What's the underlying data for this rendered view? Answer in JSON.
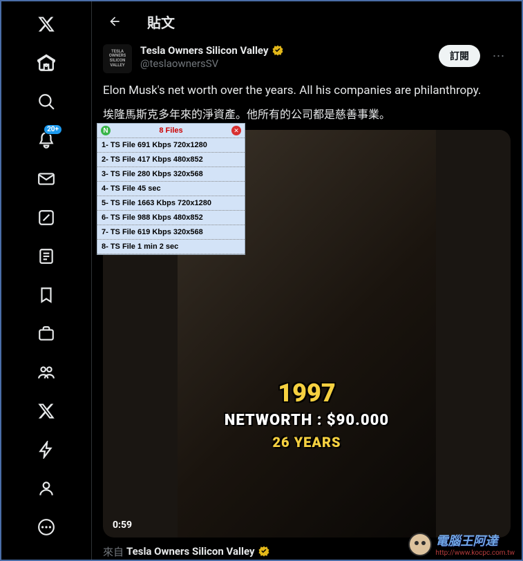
{
  "header": {
    "title": "貼文"
  },
  "notif_count": "20+",
  "post": {
    "avatar_text": "TESLA OWNERS SILICON VALLEY",
    "author": "Tesla Owners Silicon Valley",
    "handle": "@teslaownersSV",
    "follow": "訂閱",
    "text_en": "Elon Musk's net worth over the years. All his companies are philanthropy.",
    "text_cn": "埃隆馬斯克多年來的淨資產。他所有的公司都是慈善事業。",
    "video": {
      "year": "1997",
      "networth": "NETWORTH : $90.000",
      "age": "26 YEARS",
      "time": "0:59"
    },
    "from_label": "來自",
    "from_name": "Tesla Owners Silicon Valley"
  },
  "downloader": {
    "title": "8 Files",
    "items": [
      "1- TS File 691 Kbps 720x1280",
      "2- TS File 417 Kbps 480x852",
      "3- TS File 280 Kbps 320x568",
      "4- TS File 45 sec",
      "5- TS File 1663 Kbps 720x1280",
      "6- TS File 988 Kbps 480x852",
      "7- TS File 619 Kbps 320x568",
      "8- TS File 1 min 2 sec"
    ]
  },
  "watermark": {
    "main": "電腦王阿達",
    "url": "http://www.kocpc.com.tw"
  }
}
